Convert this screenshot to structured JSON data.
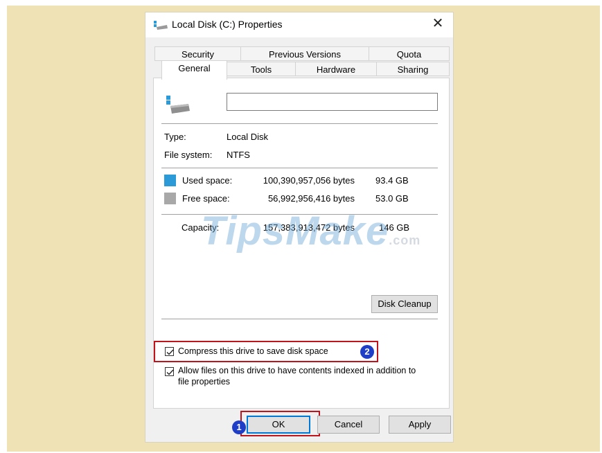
{
  "window": {
    "title": "Local Disk (C:) Properties",
    "close_glyph": "✕"
  },
  "tabs": {
    "row1": [
      "Security",
      "Previous Versions",
      "Quota"
    ],
    "row2": [
      "General",
      "Tools",
      "Hardware",
      "Sharing"
    ],
    "active": "General"
  },
  "general": {
    "drive_name_value": "",
    "type_label": "Type:",
    "type_value": "Local Disk",
    "fs_label": "File system:",
    "fs_value": "NTFS",
    "used_label": "Used space:",
    "used_bytes": "100,390,957,056 bytes",
    "used_gb": "93.4 GB",
    "free_label": "Free space:",
    "free_bytes": "56,992,956,416 bytes",
    "free_gb": "53.0 GB",
    "capacity_label": "Capacity:",
    "capacity_bytes": "157,383,913,472 bytes",
    "capacity_gb": "146 GB",
    "disk_cleanup_label": "Disk Cleanup",
    "compress_label": "Compress this drive to save disk space",
    "compress_checked": true,
    "index_label_line1": "Allow files on this drive to have contents indexed in addition to",
    "index_label_line2": "file properties",
    "index_checked": true,
    "used_color": "#2b9ad6",
    "free_color": "#a8a8a8"
  },
  "buttons": {
    "ok": "OK",
    "cancel": "Cancel",
    "apply": "Apply"
  },
  "annotations": {
    "badge_ok": "1",
    "badge_compress": "2",
    "highlight_color": "#c0141c",
    "badge_color": "#1f3ec8"
  },
  "watermark": {
    "main": "TipsMake",
    "suffix": ".com"
  }
}
